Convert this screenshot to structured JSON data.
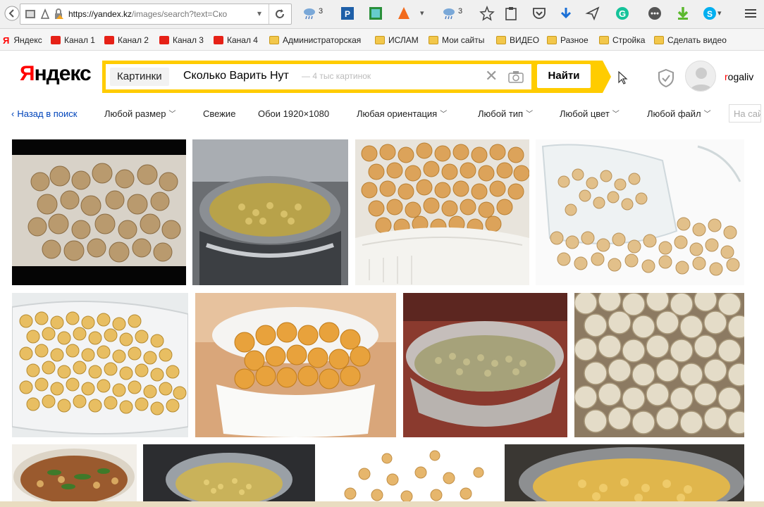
{
  "browser": {
    "url_host": "https://yandex.kz",
    "url_path": "/images/search?text=Ско",
    "weather_badge_1": "3",
    "weather_badge_2": "3"
  },
  "bookmarks": [
    {
      "label": "Яндекс",
      "icon": "yandex-icon"
    },
    {
      "label": "Канал 1",
      "icon": "youtube-icon"
    },
    {
      "label": "Канал 2",
      "icon": "youtube-icon"
    },
    {
      "label": "Канал 3",
      "icon": "youtube-icon"
    },
    {
      "label": "Канал 4",
      "icon": "youtube-icon"
    },
    {
      "label": "Администраторская",
      "icon": "folder-icon"
    },
    {
      "label": "ИСЛАМ",
      "icon": "folder-icon"
    },
    {
      "label": "Мои сайты",
      "icon": "folder-icon"
    },
    {
      "label": "ВИДЕО",
      "icon": "folder-icon"
    },
    {
      "label": "Разное",
      "icon": "folder-icon"
    },
    {
      "label": "Стройка",
      "icon": "folder-icon"
    },
    {
      "label": "Сделать видео",
      "icon": "folder-icon"
    }
  ],
  "header": {
    "logo_first": "Я",
    "logo_rest": "ндекс",
    "search_tab": "Картинки",
    "query": "Сколько Варить Нут",
    "query_hint": "— 4 тыс картинок",
    "find_button": "Найти",
    "user_first": "r",
    "user_rest": "ogaliv"
  },
  "filters": {
    "back": "Назад в поиск",
    "size": "Любой размер",
    "fresh": "Свежие",
    "wallpapers": "Обои 1920×1080",
    "orientation": "Любая ориентация",
    "type": "Любой тип",
    "color": "Любой цвет",
    "file": "Любой файл",
    "site_placeholder": "На сайте"
  },
  "images": [
    {
      "name": "dried-chickpeas-on-dark-background",
      "subject": "chickpeas"
    },
    {
      "name": "chickpeas-boiling-in-pot",
      "subject": "chickpeas"
    },
    {
      "name": "chickpeas-in-white-bowl",
      "subject": "chickpeas"
    },
    {
      "name": "chickpeas-spilling-from-jar",
      "subject": "chickpeas"
    },
    {
      "name": "chickpeas-in-colander",
      "subject": "chickpeas"
    },
    {
      "name": "chickpeas-in-small-white-bowl",
      "subject": "chickpeas"
    },
    {
      "name": "chickpeas-soaking-in-glass-bowl",
      "subject": "chickpeas"
    },
    {
      "name": "dried-chickpeas-close-up",
      "subject": "chickpeas"
    },
    {
      "name": "chickpea-soup-bowl",
      "subject": "chickpeas"
    },
    {
      "name": "chickpeas-cooking-on-stove",
      "subject": "chickpeas"
    },
    {
      "name": "scattered-chickpeas-white-background",
      "subject": "chickpeas"
    },
    {
      "name": "chickpeas-in-steel-pot",
      "subject": "chickpeas"
    }
  ],
  "colors": {
    "yandex_yellow": "#ffcc00",
    "yandex_red": "#ff0000",
    "link_blue": "#0044bb",
    "chickpea": "#e0b169"
  }
}
